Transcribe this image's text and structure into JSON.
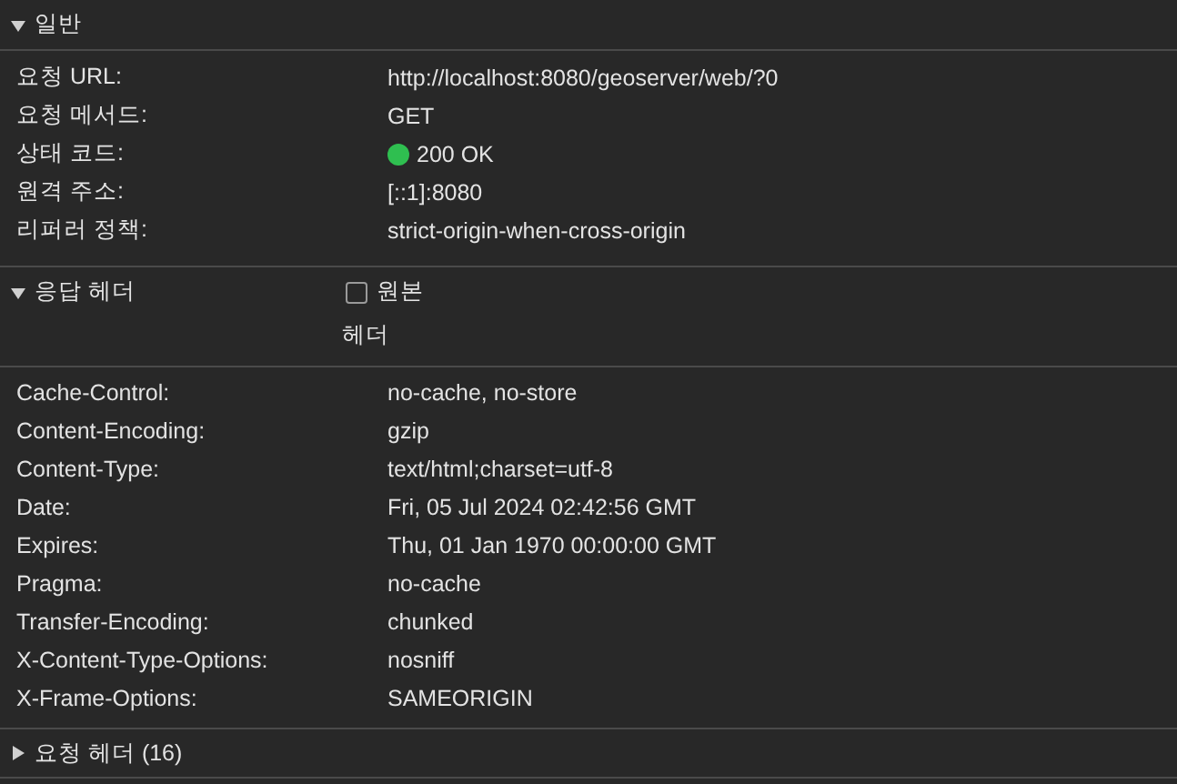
{
  "general": {
    "title": "일반",
    "expanded": true,
    "rows": [
      {
        "kind": "text",
        "label": "요청 URL:",
        "value": "http://localhost:8080/geoserver/web/?0"
      },
      {
        "kind": "text",
        "label": "요청 메서드:",
        "value": "GET"
      },
      {
        "kind": "status",
        "label": "상태 코드:",
        "value": "200 OK",
        "color": "#2fbf50"
      },
      {
        "kind": "text",
        "label": "원격 주소:",
        "value": "[::1]:8080"
      },
      {
        "kind": "text",
        "label": "리퍼러 정책:",
        "value": "strict-origin-when-cross-origin"
      }
    ]
  },
  "response_headers": {
    "title": "응답 헤더",
    "expanded": true,
    "raw_toggle": {
      "label": "원본",
      "checked": false
    },
    "column_header": "헤더",
    "rows": [
      {
        "label": "Cache-Control:",
        "value": "no-cache, no-store"
      },
      {
        "label": "Content-Encoding:",
        "value": "gzip"
      },
      {
        "label": "Content-Type:",
        "value": "text/html;charset=utf-8"
      },
      {
        "label": "Date:",
        "value": "Fri, 05 Jul 2024 02:42:56 GMT"
      },
      {
        "label": "Expires:",
        "value": "Thu, 01 Jan 1970 00:00:00 GMT"
      },
      {
        "label": "Pragma:",
        "value": "no-cache"
      },
      {
        "label": "Transfer-Encoding:",
        "value": "chunked"
      },
      {
        "label": "X-Content-Type-Options:",
        "value": "nosniff"
      },
      {
        "label": "X-Frame-Options:",
        "value": "SAMEORIGIN"
      }
    ]
  },
  "request_headers": {
    "title": "요청 헤더",
    "count": "(16)",
    "expanded": false
  }
}
